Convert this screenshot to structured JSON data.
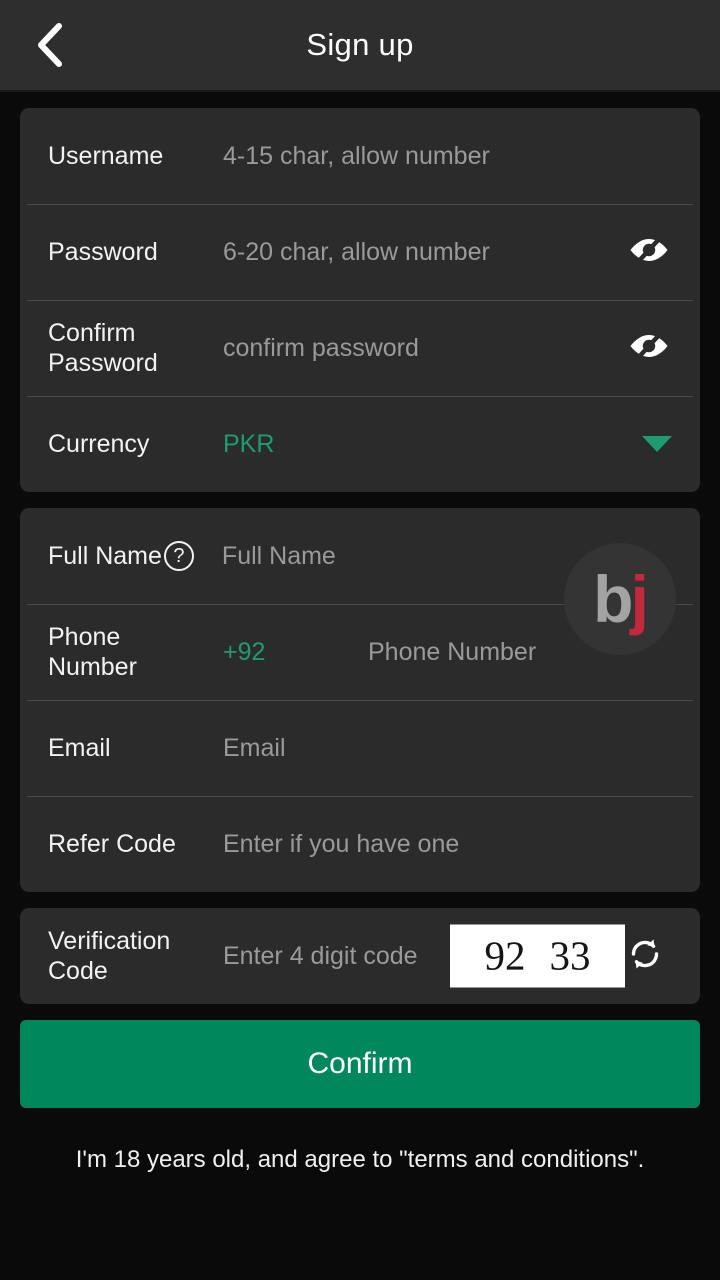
{
  "header": {
    "title": "Sign up",
    "back_icon": "chevron-left-icon"
  },
  "account_card": {
    "rows": [
      {
        "label": "Username",
        "placeholder": "4-15 char, allow number",
        "value": ""
      },
      {
        "label": "Password",
        "placeholder": "6-20 char, allow number",
        "value": "",
        "trailing_icon": "eye-off-icon"
      },
      {
        "label": "Confirm\nPassword",
        "placeholder": "confirm password",
        "value": "",
        "trailing_icon": "eye-off-icon"
      },
      {
        "label": "Currency",
        "value": "PKR",
        "trailing_icon": "chevron-down-icon"
      }
    ]
  },
  "profile_card": {
    "rows": [
      {
        "label": "Full Name",
        "help_icon": "question-mark-icon",
        "placeholder": "Full Name",
        "value": ""
      },
      {
        "label": "Phone\nNumber",
        "country_code": "+92",
        "placeholder": "Phone Number",
        "value": ""
      },
      {
        "label": "Email",
        "placeholder": "Email",
        "value": ""
      },
      {
        "label": "Refer Code",
        "placeholder": "Enter if you have one",
        "value": ""
      }
    ],
    "watermark": {
      "letter_one": "b",
      "letter_two": "j"
    }
  },
  "verification_card": {
    "label": "Verification\nCode",
    "placeholder": "Enter 4 digit code",
    "value": "",
    "captcha": {
      "left_digits": "92",
      "right_digits": "33"
    },
    "refresh_icon": "refresh-icon"
  },
  "footer": {
    "confirm_label": "Confirm",
    "terms_text": "I'm 18 years old, and agree to \"terms and conditions\"."
  },
  "colors": {
    "accent_green": "#1f9c6f",
    "button_green": "#00875b",
    "card_bg": "#2b2b2b",
    "page_bg": "#0a0a0a",
    "header_bg": "#2e2e2e",
    "placeholder": "#9a9a9a",
    "watermark_red": "#c3283c",
    "watermark_gray": "#a3a3a3"
  }
}
